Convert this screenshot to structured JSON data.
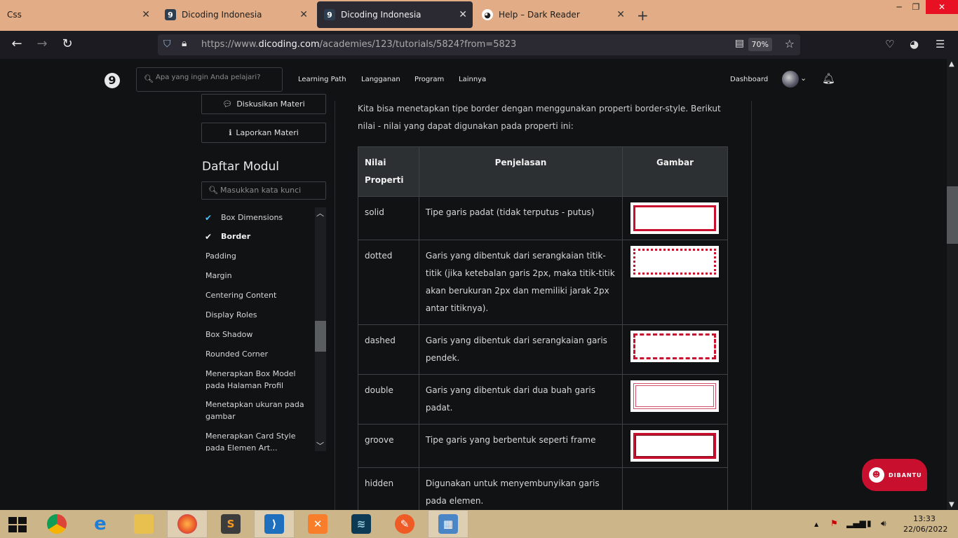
{
  "browser": {
    "tabs": [
      {
        "title": "Css",
        "favicon": "none"
      },
      {
        "title": "Dicoding Indonesia",
        "favicon": "dicoding-icon"
      },
      {
        "title": "Dicoding Indonesia",
        "favicon": "dicoding-icon",
        "active": true
      },
      {
        "title": "Help – Dark Reader",
        "favicon": "dark-reader-icon"
      }
    ],
    "new_tab_label": "+",
    "url_prefix": "https://www.",
    "url_domain": "dicoding.com",
    "url_path": "/academies/123/tutorials/5824?from=5823",
    "zoom": "70%"
  },
  "site": {
    "logo": "9",
    "search_placeholder": "Apa yang ingin Anda pelajari?",
    "menu": [
      "Learning Path",
      "Langganan",
      "Program",
      "Lainnya"
    ],
    "dashboard": "Dashboard"
  },
  "sidebar": {
    "discuss_button": "Diskusikan Materi",
    "report_button": "Laporkan Materi",
    "module_title": "Daftar Modul",
    "module_search_placeholder": "Masukkan kata kunci",
    "modules": [
      {
        "label": "Box Dimensions",
        "done": true,
        "current": false
      },
      {
        "label": "Border",
        "done": true,
        "current": true
      },
      {
        "label": "Padding",
        "done": false,
        "current": false
      },
      {
        "label": "Margin",
        "done": false,
        "current": false
      },
      {
        "label": "Centering Content",
        "done": false,
        "current": false
      },
      {
        "label": "Display Roles",
        "done": false,
        "current": false
      },
      {
        "label": "Box Shadow",
        "done": false,
        "current": false
      },
      {
        "label": "Rounded Corner",
        "done": false,
        "current": false
      },
      {
        "label": "Menerapkan Box Model pada Halaman Profil",
        "done": false,
        "current": false
      },
      {
        "label": "Menetapkan ukuran pada gambar",
        "done": false,
        "current": false
      },
      {
        "label": "Menerapkan Card Style pada Elemen Art...",
        "done": false,
        "current": false
      }
    ]
  },
  "content": {
    "intro": "Kita bisa menetapkan tipe border dengan menggunakan properti border-style. Berikut nilai - nilai yang dapat digunakan pada properti ini:",
    "table": {
      "headers": [
        "Nilai Properti",
        "Penjelasan",
        "Gambar"
      ],
      "rows": [
        {
          "value": "solid",
          "desc": "Tipe garis padat (tidak terputus - putus)",
          "sample": "solid"
        },
        {
          "value": "dotted",
          "desc": "Garis yang dibentuk dari serangkaian titik-titik (jika ketebalan garis 2px, maka titik-titik akan berukuran 2px dan memiliki jarak 2px antar titiknya).",
          "sample": "dotted"
        },
        {
          "value": "dashed",
          "desc": "Garis yang dibentuk dari serangkaian garis pendek.",
          "sample": "dashed"
        },
        {
          "value": "double",
          "desc": "Garis yang dibentuk dari dua buah garis padat.",
          "sample": "double"
        },
        {
          "value": "groove",
          "desc": "Tipe garis yang berbentuk seperti frame",
          "sample": "groove"
        },
        {
          "value": "hidden",
          "desc": "Digunakan untuk menyembunyikan garis pada elemen.",
          "sample": "none"
        }
      ]
    }
  },
  "help_button": "DIBANTU",
  "taskbar": {
    "time": "13:33",
    "date": "22/06/2022"
  },
  "colors": {
    "accent": "#c8102e",
    "check": "#4fc3f7",
    "tabstrip": "#e2ad86",
    "taskbar": "#cdb58a"
  }
}
